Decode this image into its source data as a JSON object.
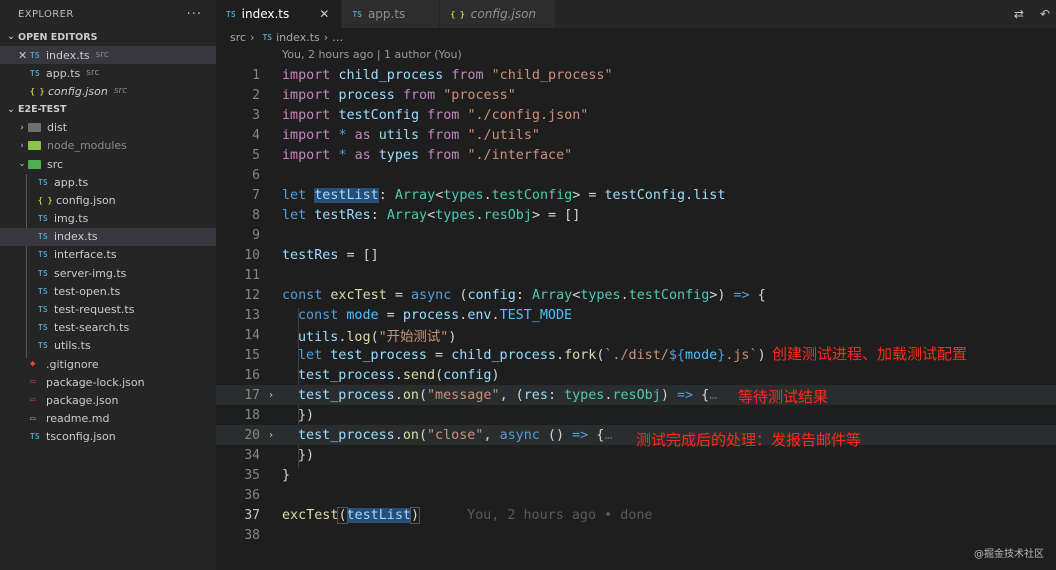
{
  "colors": {
    "ts_badge": "#519aba",
    "json_badge": "#cbcb41",
    "annotation": "#ff2a1a",
    "selection": "#264f78"
  },
  "sidebar": {
    "title": "EXPLORER",
    "more": "···",
    "open_editors": {
      "heading": "OPEN EDITORS",
      "items": [
        {
          "close": "✕",
          "badge": "TS",
          "name": "index.ts",
          "desc": "src"
        },
        {
          "badge": "TS",
          "name": "app.ts",
          "desc": "src"
        },
        {
          "badge": "{ }",
          "name": "config.json",
          "desc": "src"
        }
      ]
    },
    "project": {
      "heading": "E2E-TEST",
      "items": [
        {
          "name": "dist",
          "chev": "›"
        },
        {
          "name": "node_modules",
          "chev": "›"
        },
        {
          "name": "src",
          "chev": "⌄"
        },
        {
          "badge": "TS",
          "name": "app.ts"
        },
        {
          "badge": "{ }",
          "name": "config.json"
        },
        {
          "badge": "TS",
          "name": "img.ts"
        },
        {
          "badge": "TS",
          "name": "index.ts"
        },
        {
          "badge": "TS",
          "name": "interface.ts"
        },
        {
          "badge": "TS",
          "name": "server-img.ts"
        },
        {
          "badge": "TS",
          "name": "test-open.ts"
        },
        {
          "badge": "TS",
          "name": "test-request.ts"
        },
        {
          "badge": "TS",
          "name": "test-search.ts"
        },
        {
          "badge": "TS",
          "name": "utils.ts"
        },
        {
          "name": ".gitignore"
        },
        {
          "name": "package-lock.json"
        },
        {
          "name": "package.json"
        },
        {
          "name": "readme.md"
        },
        {
          "name": "tsconfig.json"
        }
      ]
    }
  },
  "tabs": [
    {
      "badge": "TS",
      "label": "index.ts",
      "close": "✕"
    },
    {
      "badge": "TS",
      "label": "app.ts"
    },
    {
      "badge": "{ }",
      "label": "config.json"
    }
  ],
  "breadcrumb": {
    "folder": "src",
    "sep": "›",
    "badge": "TS",
    "file": "index.ts",
    "tail": "…"
  },
  "editor": {
    "blame": "You, 2 hours ago | 1 author (You)",
    "line_numbers": [
      "1",
      "2",
      "3",
      "4",
      "5",
      "6",
      "7",
      "8",
      "9",
      "10",
      "11",
      "12",
      "13",
      "14",
      "15",
      "16",
      "17",
      "18",
      "20",
      "34",
      "35",
      "36",
      "37",
      "38"
    ],
    "lines": {
      "l1": [
        "import",
        " ",
        "child_process",
        " ",
        "from",
        " ",
        "\"child_process\""
      ],
      "l2": [
        "import",
        " ",
        "process",
        " ",
        "from",
        " ",
        "\"process\""
      ],
      "l3": [
        "import",
        " ",
        "testConfig",
        " ",
        "from",
        " ",
        "\"./config.json\""
      ],
      "l4": [
        "import",
        " ",
        "*",
        " ",
        "as",
        " ",
        "utils",
        " ",
        "from",
        " ",
        "\"./utils\""
      ],
      "l5": [
        "import",
        " ",
        "*",
        " ",
        "as",
        " ",
        "types",
        " ",
        "from",
        " ",
        "\"./interface\""
      ],
      "l7": [
        "let",
        " ",
        "testList",
        ": ",
        "Array",
        "<",
        "types",
        ".",
        "testConfig",
        "> = ",
        "testConfig",
        ".",
        "list"
      ],
      "l8": [
        "let",
        " ",
        "testRes",
        ": ",
        "Array",
        "<",
        "types",
        ".",
        "resObj",
        "> = []"
      ],
      "l10": [
        "testRes",
        " = []"
      ],
      "l12": [
        "const",
        " ",
        "excTest",
        " = ",
        "async",
        " (",
        "config",
        ": ",
        "Array",
        "<",
        "types",
        ".",
        "testConfig",
        ">) ",
        "=>",
        " {"
      ],
      "l13": [
        "const",
        " ",
        "mode",
        " = ",
        "process",
        ".",
        "env",
        ".",
        "TEST_MODE"
      ],
      "l14": [
        "utils",
        ".",
        "log",
        "(",
        "\"开始测试\"",
        ")"
      ],
      "l15": [
        "let",
        " ",
        "test_process",
        " = ",
        "child_process",
        ".",
        "fork",
        "(",
        "`./dist/",
        "${",
        "mode",
        "}",
        ".js`",
        ")"
      ],
      "l16": [
        "test_process",
        ".",
        "send",
        "(",
        "config",
        ")"
      ],
      "l17": [
        "test_process",
        ".",
        "on",
        "(",
        "\"message\"",
        ", (",
        "res",
        ": ",
        "types",
        ".",
        "resObj",
        ") ",
        "=>",
        " {",
        "…"
      ],
      "l18": [
        "})"
      ],
      "l20": [
        "test_process",
        ".",
        "on",
        "(",
        "\"close\"",
        ", ",
        "async",
        " () ",
        "=>",
        " {",
        "…"
      ],
      "l34": [
        "})"
      ],
      "l35": [
        "}"
      ],
      "l37": [
        "excTest",
        "(",
        "testList",
        ")",
        "You, 2 hours ago • done"
      ]
    },
    "fold_marker": "›",
    "annotations": {
      "a15": "创建测试进程、加载测试配置",
      "a17": "等待测试结果",
      "a20": "测试完成后的处理：发报告邮件等"
    }
  },
  "watermark": "@掘金技术社区"
}
